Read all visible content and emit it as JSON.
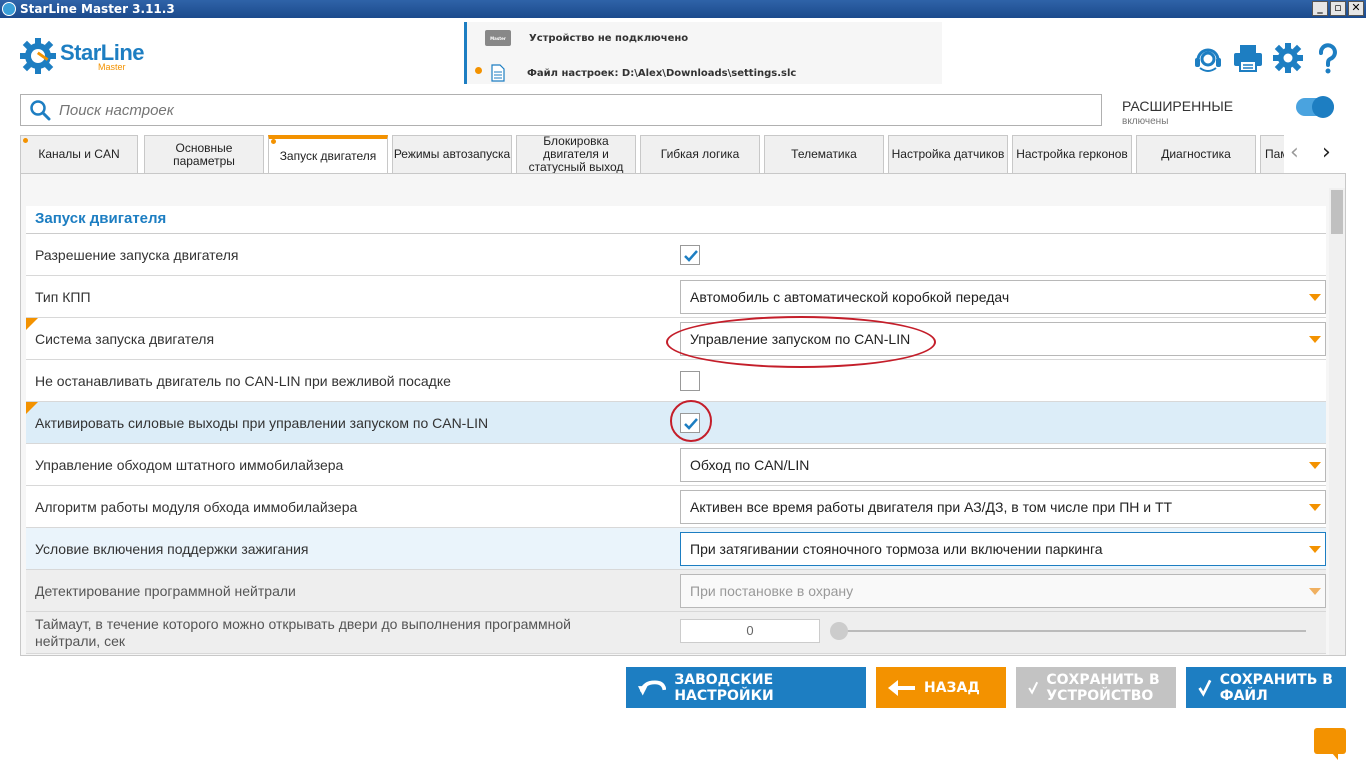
{
  "window": {
    "title": "StarLine Master 3.11.3"
  },
  "logo": {
    "title": "StarLine",
    "sub": "Master"
  },
  "device": {
    "status": "Устройство не подключено",
    "file": "Файл настроек: D:\\Alex\\Downloads\\settings.slc",
    "device_icon_label": "Master"
  },
  "header_icons": [
    "support-icon",
    "printer-icon",
    "gear-icon",
    "help-icon"
  ],
  "search": {
    "placeholder": "Поиск настроек"
  },
  "advanced": {
    "title": "РАСШИРЕННЫЕ",
    "state": "включены"
  },
  "tabs": [
    {
      "label": "Каналы и CAN",
      "dot": true
    },
    {
      "label": "Основные параметры",
      "dot": false
    },
    {
      "label": "Запуск двигателя",
      "dot": true,
      "active": true
    },
    {
      "label": "Режимы автозапуска",
      "dot": false
    },
    {
      "label": "Блокировка двигателя и статусный выход",
      "dot": false
    },
    {
      "label": "Гибкая логика",
      "dot": false
    },
    {
      "label": "Телематика",
      "dot": false
    },
    {
      "label": "Настройка датчиков",
      "dot": false
    },
    {
      "label": "Настройка герконов",
      "dot": false
    },
    {
      "label": "Диагностика",
      "dot": false
    },
    {
      "label": "Пам",
      "dot": false
    }
  ],
  "section": {
    "title": "Запуск двигателя"
  },
  "rows": [
    {
      "label": "Разрешение запуска двигателя",
      "type": "checkbox",
      "checked": true
    },
    {
      "label": "Тип КПП",
      "type": "select",
      "value": "Автомобиль с автоматической коробкой передач"
    },
    {
      "label": "Система запуска двигателя",
      "type": "select",
      "value": "Управление запуском по CAN-LIN",
      "changed": true
    },
    {
      "label": "Не останавливать двигатель по CAN-LIN при вежливой посадке",
      "type": "checkbox",
      "checked": false
    },
    {
      "label": "Активировать силовые выходы при управлении запуском по CAN-LIN",
      "type": "checkbox",
      "checked": true,
      "changed": true
    },
    {
      "label": "Управление обходом штатного иммобилайзера",
      "type": "select",
      "value": "Обход по CAN/LIN"
    },
    {
      "label": "Алгоритм работы модуля обхода иммобилайзера",
      "type": "select",
      "value": "Активен все время работы двигателя при АЗ/ДЗ, в том числе при ПН и ТТ"
    },
    {
      "label": "Условие включения поддержки зажигания",
      "type": "select",
      "value": "При затягивании стояночного тормоза или включении паркинга"
    },
    {
      "label": "Детектирование программной нейтрали",
      "type": "select",
      "value": "При постановке в охрану",
      "disabled": true
    },
    {
      "label": "Таймаут, в течение которого можно открывать двери до выполнения программной нейтрали, сек",
      "type": "slider",
      "value": "0"
    }
  ],
  "buttons": {
    "factory": "ЗАВОДСКИЕ НАСТРОЙКИ",
    "back": "НАЗАД",
    "save_device": "СОХРАНИТЬ В УСТРОЙСТВО",
    "save_file": "СОХРАНИТЬ В ФАЙЛ"
  },
  "colors": {
    "accent": "#1d7ec2",
    "orange": "#f39200",
    "highlight": "#dcedf8",
    "annotation": "#c41e2a"
  }
}
